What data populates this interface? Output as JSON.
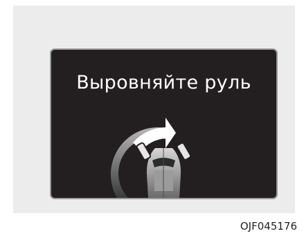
{
  "screen": {
    "message": "Выровняйте руль"
  },
  "figure_code": "OJF045176",
  "colors": {
    "screen_bg": "#231f20",
    "screen_border": "#9a9a9a",
    "panel_bg": "#ececec",
    "text": "#ffffff",
    "arrow": "#ffffff",
    "ring": "#8a8a8a"
  },
  "icons": [
    "steering-arc-icon",
    "curved-arrow-icon",
    "car-top-view-icon"
  ]
}
